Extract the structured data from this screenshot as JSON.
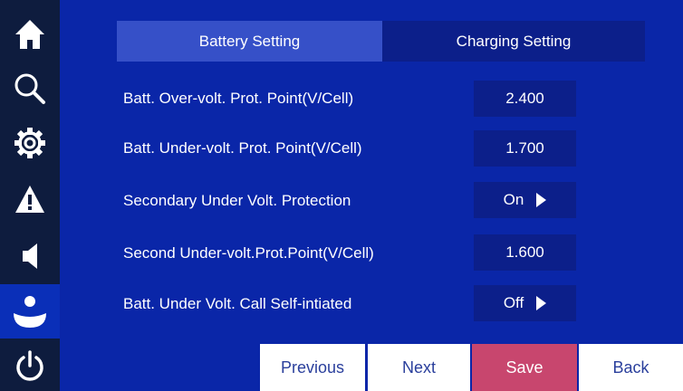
{
  "sidebar": {
    "icons": [
      "home-icon",
      "search-icon",
      "gear-icon",
      "warning-icon",
      "speaker-icon",
      "user-icon",
      "power-icon"
    ]
  },
  "tabs": [
    {
      "label": "Battery Setting",
      "active": true
    },
    {
      "label": "Charging Setting",
      "active": false
    }
  ],
  "settings": [
    {
      "label": "Batt. Over-volt. Prot. Point(V/Cell)",
      "value": "2.400",
      "dropdown": false
    },
    {
      "label": "Batt. Under-volt. Prot. Point(V/Cell)",
      "value": "1.700",
      "dropdown": false
    },
    {
      "label": "Secondary Under Volt. Protection",
      "value": "On",
      "dropdown": true
    },
    {
      "label": "Second Under-volt.Prot.Point(V/Cell)",
      "value": "1.600",
      "dropdown": false
    },
    {
      "label": "Batt. Under Volt. Call Self-intiated",
      "value": "Off",
      "dropdown": true
    }
  ],
  "buttons": {
    "previous": "Previous",
    "next": "Next",
    "save": "Save",
    "back": "Back"
  },
  "colors": {
    "background": "#0a26a8",
    "sidebar": "#0e1c3e",
    "tab_active": "#3650c8",
    "value_box": "#0c1f8a",
    "save_button": "#c8466e",
    "button": "#ffffff"
  }
}
